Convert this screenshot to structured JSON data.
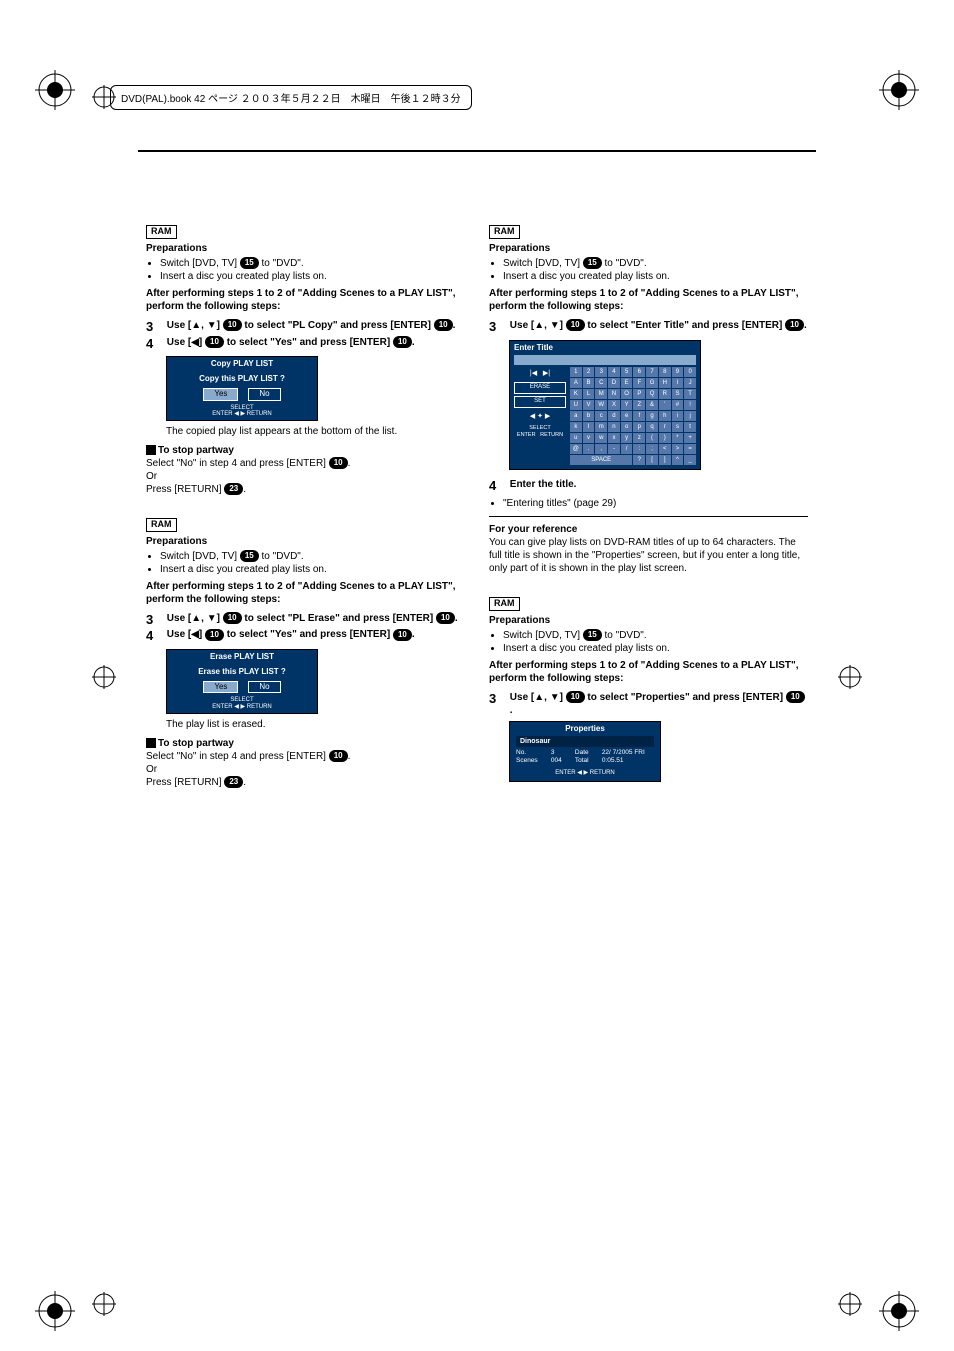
{
  "header": "DVD(PAL).book  42 ページ  ２００３年５月２２日　木曜日　午後１２時３分",
  "badges": {
    "ram": "RAM",
    "b10": "10",
    "b15": "15",
    "b23": "23"
  },
  "common": {
    "preparations": "Preparations",
    "switchdvd_pre": "Switch [DVD, TV] ",
    "switchdvd_post": " to \"DVD\".",
    "insert": "Insert a disc you created play lists on.",
    "afterperforming": "After performing steps 1 to 2 of \"Adding Scenes to a PLAY LIST\", perform the following steps:"
  },
  "copy": {
    "step3_a": "Use [▲, ▼] ",
    "step3_b": " to select \"PL Copy\" and press [ENTER] ",
    "step3_c": ".",
    "step4_a": "Use [◀] ",
    "step4_b": " to select \"Yes\" and press [ENTER] ",
    "step4_c": ".",
    "dialog_title": "Copy PLAY LIST",
    "dialog_q": "Copy this PLAY LIST ?",
    "yes": "Yes",
    "no": "No",
    "navhint1": "SELECT",
    "navhint2": "ENTER   ◀ ▶   RETURN",
    "after": "The copied play list appears at the bottom of the list.",
    "stop_hd": "To stop partway",
    "stop1a": "Select \"No\" in step 4 and press [ENTER] ",
    "stop1b": ".",
    "or": "Or",
    "stop2a": "Press [RETURN] ",
    "stop2b": "."
  },
  "erase": {
    "step3_a": "Use [▲, ▼] ",
    "step3_b": " to select \"PL Erase\" and press [ENTER] ",
    "step3_c": ".",
    "step4_a": "Use [◀] ",
    "step4_b": " to select \"Yes\" and press [ENTER] ",
    "step4_c": ".",
    "dialog_title": "Erase PLAY LIST",
    "dialog_q": "Erase this PLAY LIST ?",
    "after": "The play list is erased."
  },
  "titling": {
    "step3_a": "Use [▲, ▼] ",
    "step3_b": " to select \"Enter Title\" and press [ENTER] ",
    "step3_c": ".",
    "dlg_bar": "Enter Title",
    "left_erase": "ERASE",
    "left_set": "SET",
    "left_select": "SELECT",
    "left_enter": "ENTER",
    "left_return": "RETURN",
    "space": "SPACE",
    "step4": "Enter the title.",
    "step4_note": "\"Entering titles\" (page 29)",
    "ref_hd": "For your reference",
    "ref_body": "You can give play lists on DVD-RAM titles of up to 64 characters. The full title is shown in the \"Properties\" screen, but if you enter a long title, only part of it is shown in the play list screen."
  },
  "props": {
    "step3_a": "Use [▲, ▼] ",
    "step3_b": " to select \"Properties\" and press [ENTER] ",
    "step3_c": ".",
    "dlg_title": "Properties",
    "name": "Dinosaur",
    "no_l": "No.",
    "no_v": "3",
    "date_l": "Date",
    "date_v": "22/ 7/2005 FRI",
    "scenes_l": "Scenes",
    "scenes_v": "004",
    "total_l": "Total",
    "total_v": "0:05.51",
    "return": "ENTER ◀ ▶ RETURN"
  },
  "chart_data": {
    "type": "table",
    "title": "Enter Title character grid",
    "rows": [
      [
        "1",
        "2",
        "3",
        "4",
        "5",
        "6",
        "7",
        "8",
        "9",
        "0"
      ],
      [
        "A",
        "B",
        "C",
        "D",
        "E",
        "F",
        "G",
        "H",
        "I",
        "J"
      ],
      [
        "K",
        "L",
        "M",
        "N",
        "O",
        "P",
        "Q",
        "R",
        "S",
        "T"
      ],
      [
        "U",
        "V",
        "W",
        "X",
        "Y",
        "Z",
        "&",
        "'",
        "#",
        "!"
      ],
      [
        "a",
        "b",
        "c",
        "d",
        "e",
        "f",
        "g",
        "h",
        "i",
        "j"
      ],
      [
        "k",
        "l",
        "m",
        "n",
        "o",
        "p",
        "q",
        "r",
        "s",
        "t"
      ],
      [
        "u",
        "v",
        "w",
        "x",
        "y",
        "z",
        "(",
        ")",
        "*",
        "+"
      ],
      [
        "@",
        ".",
        ",",
        "-",
        "/",
        ":",
        ";",
        "<",
        ">",
        "="
      ],
      [
        "SPACE",
        "?",
        "[",
        "]",
        "^",
        "_"
      ]
    ]
  }
}
